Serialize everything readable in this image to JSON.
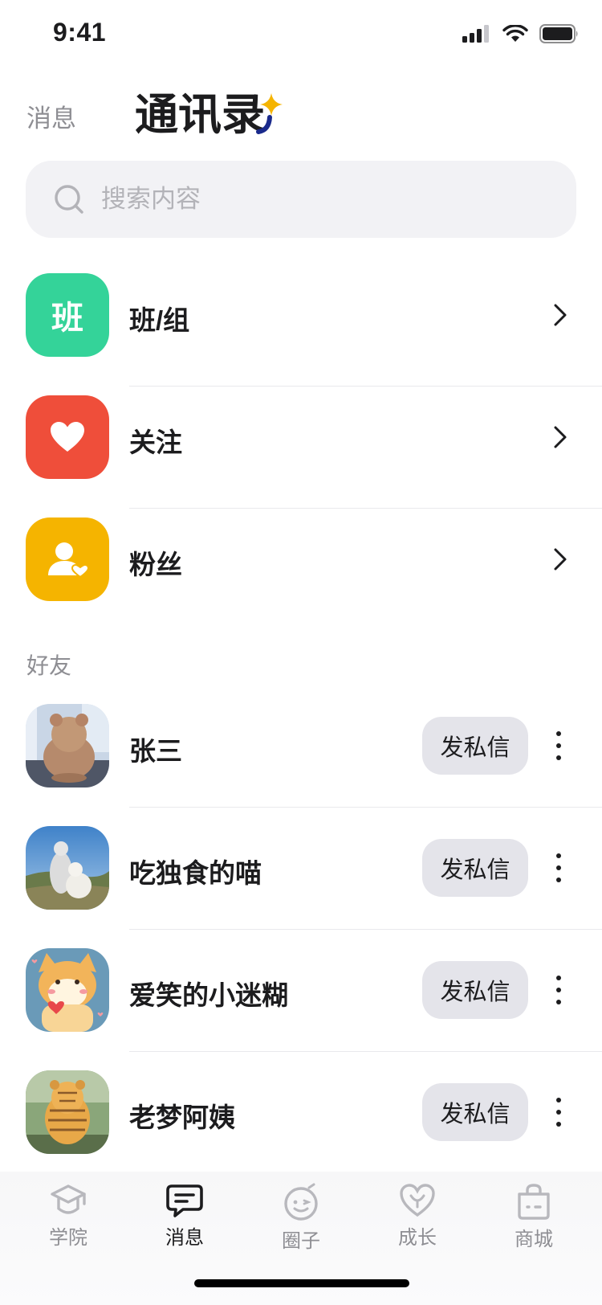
{
  "status": {
    "time": "9:41"
  },
  "header": {
    "tab_messages": "消息",
    "tab_contacts": "通讯录"
  },
  "search": {
    "placeholder": "搜索内容"
  },
  "nav": [
    {
      "label": "班/组",
      "icon": "class-icon",
      "icon_text": "班",
      "color": "#34d399"
    },
    {
      "label": "关注",
      "icon": "heart-icon",
      "color": "#ef4e3a"
    },
    {
      "label": "粉丝",
      "icon": "fans-icon",
      "color": "#f5b400"
    }
  ],
  "friends_section": {
    "title": "好友"
  },
  "friends": [
    {
      "name": "张三",
      "action": "发私信",
      "avatar": "bear-avatar"
    },
    {
      "name": "吃独食的喵",
      "action": "发私信",
      "avatar": "landscape-avatar"
    },
    {
      "name": "爱笑的小迷糊",
      "action": "发私信",
      "avatar": "shiba-avatar"
    },
    {
      "name": "老梦阿姨",
      "action": "发私信",
      "avatar": "tiger-avatar"
    }
  ],
  "tabbar": [
    {
      "label": "学院",
      "icon": "academy-icon"
    },
    {
      "label": "消息",
      "icon": "message-icon"
    },
    {
      "label": "圈子",
      "icon": "circle-icon"
    },
    {
      "label": "成长",
      "icon": "growth-icon"
    },
    {
      "label": "商城",
      "icon": "shop-icon"
    }
  ],
  "colors": {
    "accent_star": "#f5b400",
    "accent_curve": "#1a2a8c"
  }
}
